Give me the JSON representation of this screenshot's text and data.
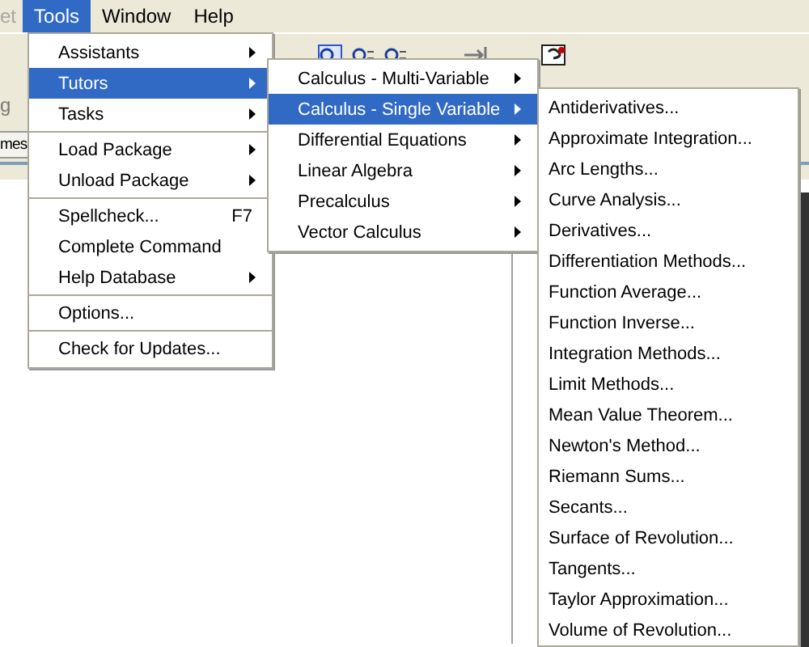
{
  "menubar": [
    {
      "label": "et",
      "selected": false,
      "disabled": true
    },
    {
      "label": "Tools",
      "selected": true,
      "disabled": false
    },
    {
      "label": "Window",
      "selected": false,
      "disabled": false
    },
    {
      "label": "Help",
      "selected": false,
      "disabled": false
    }
  ],
  "background": {
    "toolbar_label": "g",
    "tab": "mes"
  },
  "tools_menu": [
    [
      {
        "label": "Assistants",
        "submenu": true,
        "selected": false
      },
      {
        "label": "Tutors",
        "submenu": true,
        "selected": true
      },
      {
        "label": "Tasks",
        "submenu": true,
        "selected": false
      }
    ],
    [
      {
        "label": "Load Package",
        "submenu": true,
        "selected": false
      },
      {
        "label": "Unload Package",
        "submenu": true,
        "selected": false
      }
    ],
    [
      {
        "label": "Spellcheck...",
        "submenu": false,
        "selected": false,
        "shortcut": "F7"
      },
      {
        "label": "Complete Command",
        "submenu": false,
        "selected": false
      },
      {
        "label": "Help Database",
        "submenu": true,
        "selected": false
      }
    ],
    [
      {
        "label": "Options...",
        "submenu": false,
        "selected": false
      }
    ],
    [
      {
        "label": "Check for Updates...",
        "submenu": false,
        "selected": false
      }
    ]
  ],
  "tutors_menu": [
    {
      "label": "Calculus - Multi-Variable",
      "submenu": true,
      "selected": false
    },
    {
      "label": "Calculus - Single Variable",
      "submenu": true,
      "selected": true
    },
    {
      "label": "Differential Equations",
      "submenu": true,
      "selected": false
    },
    {
      "label": "Linear Algebra",
      "submenu": true,
      "selected": false
    },
    {
      "label": "Precalculus",
      "submenu": true,
      "selected": false
    },
    {
      "label": "Vector Calculus",
      "submenu": true,
      "selected": false
    }
  ],
  "single_variable_menu": [
    "Antiderivatives...",
    "Approximate Integration...",
    "Arc Lengths...",
    "Curve Analysis...",
    "Derivatives...",
    "Differentiation Methods...",
    "Function Average...",
    "Function Inverse...",
    "Integration Methods...",
    "Limit Methods...",
    "Mean Value Theorem...",
    "Newton's Method...",
    "Riemann Sums...",
    "Secants...",
    "Surface of Revolution...",
    "Tangents...",
    "Taylor Approximation...",
    "Volume of Revolution..."
  ]
}
